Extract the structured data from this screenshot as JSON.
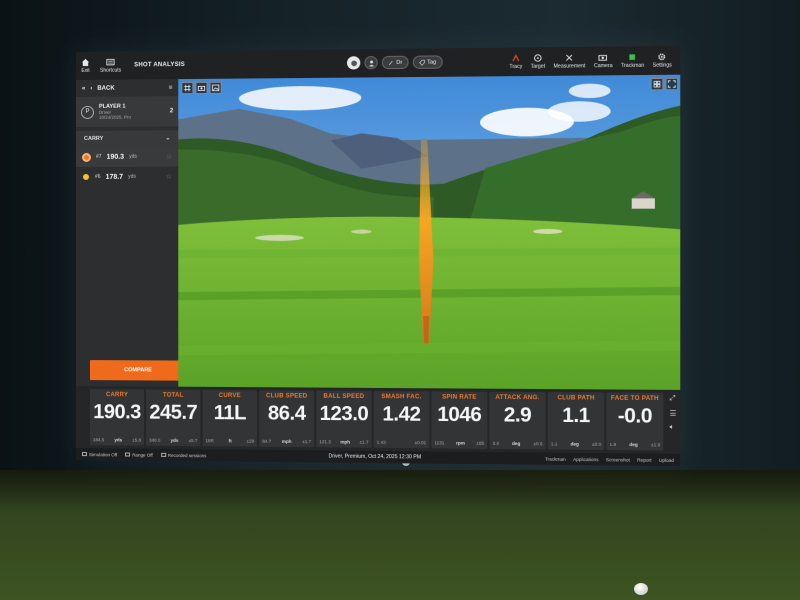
{
  "topbar": {
    "exit_label": "Exit",
    "shortcuts_label": "Shortcuts",
    "title": "SHOT ANALYSIS",
    "club_pill": "Dr",
    "tag_pill": "Tag",
    "right_items": [
      "Tracy",
      "Target",
      "Measurement",
      "Camera",
      "Trackman",
      "Settings"
    ]
  },
  "sidebar": {
    "back_label": "BACK",
    "player": {
      "avatar_letter": "P",
      "name": "PLAYER 1",
      "club": "Driver",
      "session": "10/24/2025, Pro",
      "count": "2"
    },
    "metric": "CARRY",
    "shots": [
      {
        "label": "#7",
        "value": "190.3",
        "unit": "yds"
      },
      {
        "label": "#6",
        "value": "178.7",
        "unit": "yds"
      }
    ],
    "compare_label": "COMPARE"
  },
  "tiles": [
    {
      "label": "CARRY",
      "value": "190.3",
      "left": "184.5",
      "unit": "yds",
      "right": "±5.8"
    },
    {
      "label": "TOTAL",
      "value": "245.7",
      "left": "340.0",
      "unit": "yds",
      "right": "±5.7"
    },
    {
      "label": "CURVE",
      "value": "11L",
      "left": "18R",
      "unit": "ft",
      "right": "±29"
    },
    {
      "label": "CLUB SPEED",
      "value": "86.4",
      "left": "84.7",
      "unit": "mph",
      "right": "±1.7"
    },
    {
      "label": "BALL SPEED",
      "value": "123.0",
      "left": "121.3",
      "unit": "mph",
      "right": "±1.7"
    },
    {
      "label": "SMASH FAC.",
      "value": "1.42",
      "left": "1.43",
      "unit": "",
      "right": "±0.01"
    },
    {
      "label": "SPIN RATE",
      "value": "1046",
      "left": "1131",
      "unit": "rpm",
      "right": "±85"
    },
    {
      "label": "ATTACK ANG.",
      "value": "2.9",
      "left": "3.4",
      "unit": "deg",
      "right": "±0.5"
    },
    {
      "label": "CLUB PATH",
      "value": "1.1",
      "left": "1.1",
      "unit": "deg",
      "right": "±0.0"
    },
    {
      "label": "FACE TO PATH",
      "value": "-0.0",
      "left": "1.9",
      "unit": "deg",
      "right": "±1.9"
    }
  ],
  "status": {
    "left_items": [
      "Simulation Off",
      "Range Off",
      "Recorded sessions"
    ],
    "center_text": "Driver, Premium, Oct 24, 2025 12:30 PM",
    "right_items": [
      "Trackman",
      "Applications",
      "Screenshot",
      "Report",
      "Upload"
    ]
  },
  "colors": {
    "accent": "#f06a1c",
    "tile_label": "#f07a2c",
    "trace": "#f5a623"
  },
  "icons": [
    "home-icon",
    "shortcuts-icon",
    "chevron-left-double-icon",
    "arrow-left-icon",
    "menu-icon",
    "grid-icon",
    "camera-icon",
    "image-icon",
    "expand-icon",
    "tag-icon",
    "gear-icon",
    "target-icon",
    "star-icon"
  ]
}
